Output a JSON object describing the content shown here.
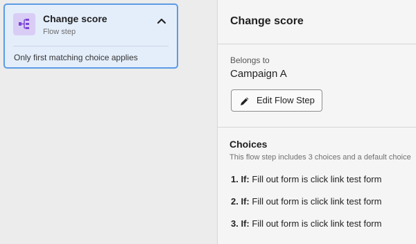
{
  "card": {
    "icon": "flow-branch-icon",
    "title": "Change score",
    "subtitle": "Flow step",
    "note": "Only first matching choice applies",
    "collapse_icon": "chevron-up-icon"
  },
  "panel": {
    "title": "Change score",
    "belongs_label": "Belongs to",
    "belongs_value": "Campaign A",
    "edit_button_label": "Edit Flow Step",
    "edit_icon": "pencil-icon",
    "choices_title": "Choices",
    "choices_description": "This flow step includes 3 choices and a default choice",
    "choices": [
      {
        "number": "1.",
        "keyword": "If:",
        "text": "Fill out form is click link test form"
      },
      {
        "number": "2.",
        "keyword": "If:",
        "text": "Fill out form is click link test form"
      },
      {
        "number": "3.",
        "keyword": "If:",
        "text": "Fill out form is click link test form"
      }
    ]
  },
  "colors": {
    "card_bg": "#e4eefb",
    "card_border": "#5a9be6",
    "icon_bg": "#d9cdf6",
    "icon_fg": "#7b46d6"
  }
}
